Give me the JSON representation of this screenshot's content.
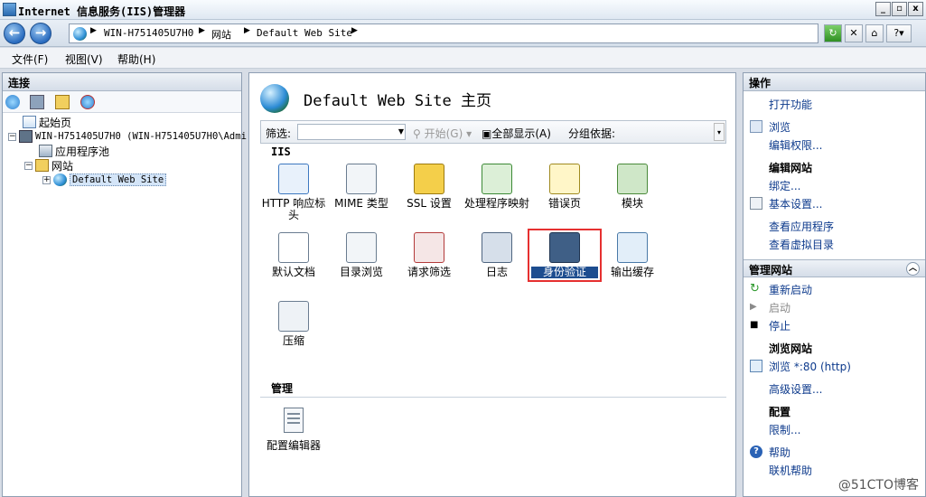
{
  "window": {
    "title": "Internet 信息服务(IIS)管理器"
  },
  "address": {
    "crumbs": [
      "WIN-H751405U7H0",
      "网站",
      "Default Web Site"
    ]
  },
  "menu": [
    "文件(F)",
    "视图(V)",
    "帮助(H)"
  ],
  "left": {
    "header": "连接",
    "tree": [
      {
        "label": "起始页"
      },
      {
        "label": "WIN-H751405U7H0 (WIN-H751405U7H0\\Admi"
      },
      {
        "label": "应用程序池"
      },
      {
        "label": "网站"
      },
      {
        "label": "Default Web Site"
      }
    ]
  },
  "center": {
    "title": "Default Web Site 主页",
    "filter": {
      "label": "筛选:",
      "start": "开始(G)",
      "show_all": "全部显示(A)",
      "group": "分组依据:"
    },
    "section_iis": "IIS",
    "section_manage": "管理",
    "features": [
      {
        "label": "HTTP 响应标头",
        "icon": "http-response-headers-icon"
      },
      {
        "label": "MIME 类型",
        "icon": "mime-types-icon"
      },
      {
        "label": "SSL 设置",
        "icon": "ssl-settings-icon"
      },
      {
        "label": "处理程序映射",
        "icon": "handler-mappings-icon"
      },
      {
        "label": "错误页",
        "icon": "error-pages-icon"
      },
      {
        "label": "模块",
        "icon": "modules-icon"
      },
      {
        "label": "默认文档",
        "icon": "default-document-icon"
      },
      {
        "label": "目录浏览",
        "icon": "directory-browsing-icon"
      },
      {
        "label": "请求筛选",
        "icon": "request-filtering-icon"
      },
      {
        "label": "日志",
        "icon": "logging-icon"
      },
      {
        "label": "身份验证",
        "icon": "authentication-icon",
        "selected": true
      },
      {
        "label": "输出缓存",
        "icon": "output-caching-icon"
      },
      {
        "label": "压缩",
        "icon": "compression-icon"
      }
    ],
    "manage_features": [
      {
        "label": "配置编辑器",
        "icon": "configuration-editor-icon"
      }
    ]
  },
  "right": {
    "header": "操作",
    "actions1": [
      "打开功能",
      "浏览",
      "编辑权限..."
    ],
    "edit_site_head": "编辑网站",
    "actions2": [
      "绑定...",
      "基本设置...",
      "查看应用程序",
      "查看虚拟目录"
    ],
    "manage_site_header": "管理网站",
    "actions3": [
      "重新启动",
      "启动",
      "停止"
    ],
    "browse_site_head": "浏览网站",
    "browse_link": "浏览 *:80 (http)",
    "advanced": "高级设置...",
    "config_head": "配置",
    "limits": "限制...",
    "help": "帮助",
    "online_help": "联机帮助"
  },
  "watermark": "@51CTO博客"
}
